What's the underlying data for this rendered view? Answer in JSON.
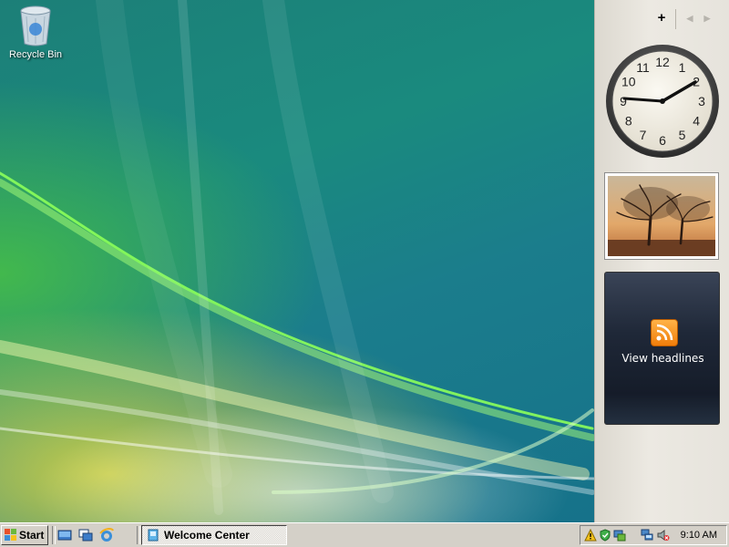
{
  "desktop": {
    "icons": [
      {
        "label": "Recycle Bin",
        "icon": "recycle-bin-icon"
      }
    ]
  },
  "sidebar": {
    "controls": {
      "add": "+",
      "prev": "◀",
      "next": "▶"
    },
    "clock": {
      "numbers": [
        "12",
        "1",
        "2",
        "3",
        "4",
        "5",
        "6",
        "7",
        "8",
        "9",
        "10",
        "11"
      ],
      "time": "9:10"
    },
    "slideshow": {
      "subject": "trees-at-dusk-image"
    },
    "feed": {
      "label": "View headlines",
      "icon": "rss-icon"
    }
  },
  "taskbar": {
    "start_label": "Start",
    "quick_launch": [
      "show-desktop-icon",
      "switch-windows-icon",
      "internet-explorer-icon"
    ],
    "tasks": [
      {
        "label": "Welcome Center",
        "icon": "welcome-center-icon"
      }
    ],
    "tray_icons": [
      "warning-icon",
      "security-icon",
      "network-status-icon",
      "network-icon",
      "volume-muted-icon"
    ],
    "clock": "9:10 AM"
  },
  "colors": {
    "taskbar": "#d4d0c8",
    "sidebar": "#ece9e2",
    "desktop_teal": "#1a8a7e",
    "feed_bg": "#1f2838",
    "rss_orange": "#f07d0a"
  }
}
